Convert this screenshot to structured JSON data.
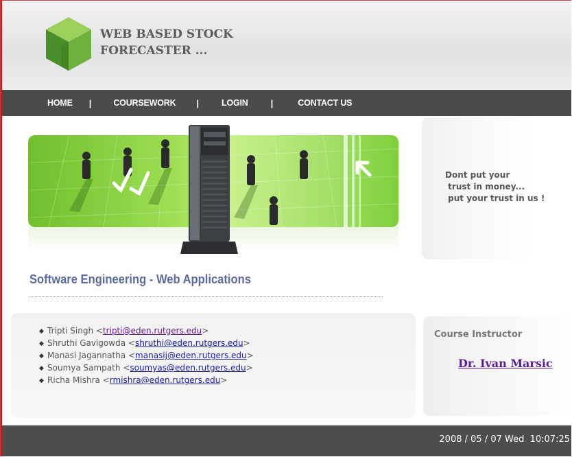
{
  "brand": {
    "line1": "WEB BASED STOCK",
    "line2": "FORECASTER ...",
    "colors": {
      "cube_top": "#9ccf5b",
      "cube_left": "#4a8f2a",
      "cube_right": "#6fb13c"
    }
  },
  "nav": {
    "items": [
      {
        "label": "HOME"
      },
      {
        "label": "COURSEWORK"
      },
      {
        "label": "LOGIN"
      },
      {
        "label": "CONTACT US"
      }
    ],
    "separator": "|"
  },
  "quote": {
    "line1": "Dont put your",
    "line2": " trust in money...",
    "line3": " put your trust in us !"
  },
  "section": {
    "title": "Software Engineering - Web Applications"
  },
  "members": [
    {
      "name": "Tripti Singh",
      "email": "tripti@eden.rutgers.edu",
      "visited": true
    },
    {
      "name": "Shruthi Gavigowda",
      "email": "shruthi@eden.rutgers.edu",
      "visited": false
    },
    {
      "name": "Manasi Jagannatha",
      "email": "manasij@eden.rutgers.edu",
      "visited": false
    },
    {
      "name": "Soumya Sampath",
      "email": "soumyas@eden.rutgers.edu",
      "visited": false
    },
    {
      "name": "Richa Mishra",
      "email": "rmishra@eden.rutgers.edu",
      "visited": false
    }
  ],
  "instructor": {
    "label": "Course Instructor",
    "name": "Dr. Ivan Marsic"
  },
  "footer": {
    "clock": "2008 / 05 / 07 Wed  10:07:25"
  },
  "colors": {
    "nav_bg": "#4b4b4b",
    "footer_bg": "#4d4d4d",
    "title": "#5d6aa1",
    "link": "#1a1aa6",
    "visited_link": "#6b1a8a",
    "instructor_link": "#5b1d8e",
    "frame_border": "#c51b1b"
  }
}
